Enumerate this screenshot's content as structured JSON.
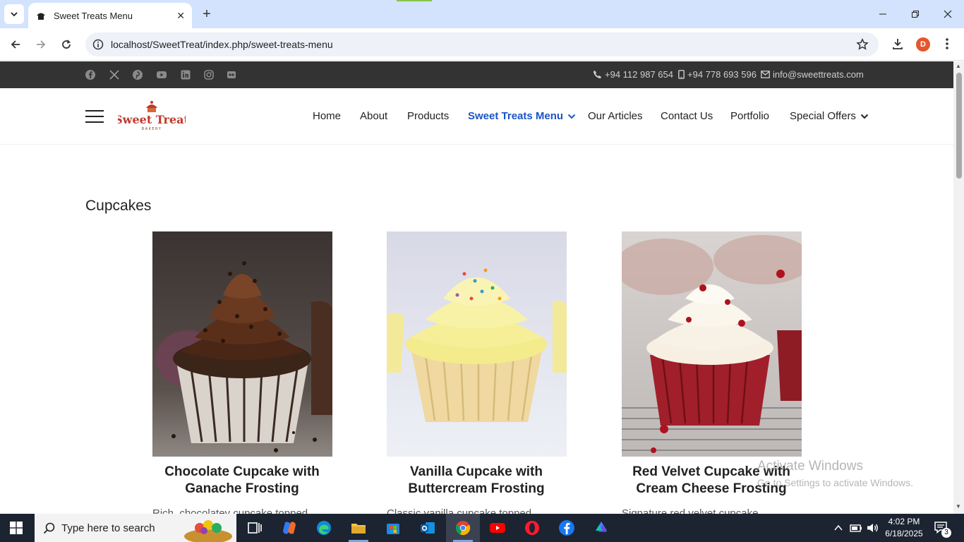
{
  "browser": {
    "tab_title": "Sweet Treats Menu",
    "url": "localhost/SweetTreat/index.php/sweet-treats-menu",
    "profile_initial": "D"
  },
  "site": {
    "top_bar": {
      "social_icons": [
        "facebook-icon",
        "x-icon",
        "pinterest-icon",
        "youtube-icon",
        "linkedin-icon",
        "instagram-icon",
        "flickr-icon"
      ],
      "phone": "+94 112 987 654",
      "mobile": "+94 778 693 596",
      "email": "info@sweettreats.com"
    },
    "logo_text": "Sweet Treat",
    "logo_subtext": "BAKERY",
    "nav": [
      {
        "label": "Home"
      },
      {
        "label": "About"
      },
      {
        "label": "Products"
      },
      {
        "label": "Sweet Treats Menu",
        "active": true,
        "dropdown": true
      },
      {
        "label": "Our Articles"
      },
      {
        "label": "Contact Us"
      },
      {
        "label": "Portfolio"
      },
      {
        "label": "Special Offers",
        "dropdown": true
      }
    ],
    "accent_color": "#1a55c5"
  },
  "content": {
    "section_title": "Cupcakes",
    "products": [
      {
        "title_line1": "Chocolate Cupcake with",
        "title_line2": "Ganache Frosting",
        "desc_start": "Rich, chocolatey cupcake topped"
      },
      {
        "title_line1": "Vanilla Cupcake with",
        "title_line2": "Buttercream Frosting",
        "desc_start": "Classic vanilla cupcake topped"
      },
      {
        "title_line1": "Red Velvet Cupcake with",
        "title_line2": "Cream Cheese Frosting",
        "desc_start": "Signature red velvet cupcake"
      }
    ]
  },
  "watermark": {
    "line1": "Activate Windows",
    "line2": "Go to Settings to activate Windows."
  },
  "taskbar": {
    "search_placeholder": "Type here to search",
    "time": "4:02 PM",
    "date": "6/18/2025",
    "notification_count": "3"
  }
}
